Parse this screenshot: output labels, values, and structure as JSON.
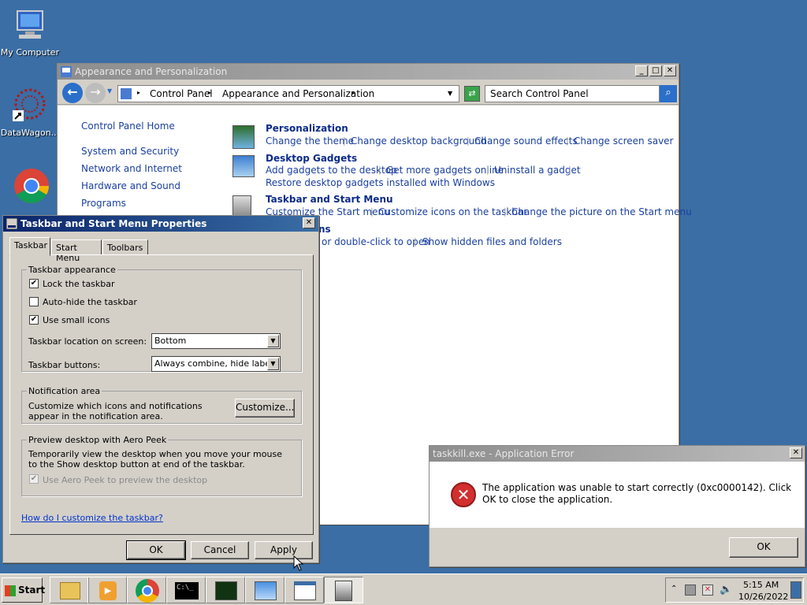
{
  "desktop": {
    "icons": [
      {
        "label": "My Computer"
      },
      {
        "label": "DataWagon..."
      },
      {
        "label": ""
      }
    ]
  },
  "control_panel": {
    "title": "Appearance and Personalization",
    "breadcrumb": [
      "Control Panel",
      "Appearance and Personalization"
    ],
    "search_placeholder": "Search Control Panel",
    "sidebar": {
      "home": "Control Panel Home",
      "items": [
        "System and Security",
        "Network and Internet",
        "Hardware and Sound",
        "Programs"
      ]
    },
    "sections": [
      {
        "heading": "Personalization",
        "links": [
          "Change the theme",
          "Change desktop background",
          "Change sound effects",
          "Change screen saver"
        ]
      },
      {
        "heading": "Desktop Gadgets",
        "links": [
          "Add gadgets to the desktop",
          "Get more gadgets online",
          "Uninstall a gadget",
          "Restore desktop gadgets installed with Windows"
        ]
      },
      {
        "heading": "Taskbar and Start Menu",
        "links": [
          "Customize the Start menu",
          "Customize icons on the taskbar",
          "Change the picture on the Start menu"
        ]
      },
      {
        "heading": "ns",
        "links": [
          "or double-click to open",
          "Show hidden files and folders"
        ]
      }
    ]
  },
  "taskbar_props": {
    "title": "Taskbar and Start Menu Properties",
    "tabs": [
      "Taskbar",
      "Start Menu",
      "Toolbars"
    ],
    "appearance": {
      "legend": "Taskbar appearance",
      "lock_label": "Lock the taskbar",
      "lock_checked": true,
      "autohide_label": "Auto-hide the taskbar",
      "autohide_checked": false,
      "small_icons_label": "Use small icons",
      "small_icons_checked": true,
      "location_label": "Taskbar location on screen:",
      "location_value": "Bottom",
      "buttons_label": "Taskbar buttons:",
      "buttons_value": "Always combine, hide labels"
    },
    "notification": {
      "legend": "Notification area",
      "text": "Customize which icons and notifications appear in the notification area.",
      "button": "Customize..."
    },
    "aero": {
      "legend": "Preview desktop with Aero Peek",
      "text": "Temporarily view the desktop when you move your mouse to the Show desktop button at end of the taskbar.",
      "checkbox": "Use Aero Peek to preview the desktop"
    },
    "help_link": "How do I customize the taskbar?",
    "ok": "OK",
    "cancel": "Cancel",
    "apply": "Apply"
  },
  "error_dialog": {
    "title": "taskkill.exe - Application Error",
    "message": "The application was unable to start correctly (0xc0000142). Click OK to close the application.",
    "ok": "OK"
  },
  "taskbar": {
    "start": "Start",
    "time": "5:15 AM",
    "date": "10/26/2022"
  },
  "colors": {
    "desktop": "#3a6ea5",
    "link": "#1a3fa0",
    "error_red": "#d32f2f"
  }
}
